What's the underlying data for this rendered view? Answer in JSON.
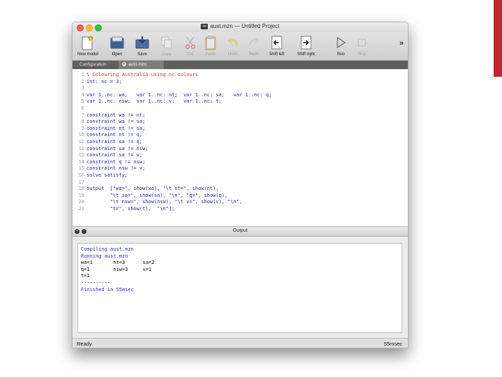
{
  "window": {
    "title": "aust.mzn — Untitled Project",
    "doc_icon": "txt"
  },
  "toolbar": {
    "buttons": [
      {
        "label": "New model",
        "icon": "new-model-icon",
        "enabled": true
      },
      {
        "label": "Open",
        "icon": "open-icon",
        "enabled": true
      },
      {
        "label": "Save",
        "icon": "save-icon",
        "enabled": true
      },
      {
        "label": "Copy",
        "icon": "copy-icon",
        "enabled": false
      },
      {
        "label": "Cut",
        "icon": "scissors-icon",
        "enabled": false
      },
      {
        "label": "Paste",
        "icon": "paste-icon",
        "enabled": false
      },
      {
        "label": "Undo",
        "icon": "undo-icon",
        "enabled": false
      },
      {
        "label": "Redo",
        "icon": "redo-icon",
        "enabled": false
      },
      {
        "label": "Shift left",
        "icon": "shift-left-icon",
        "enabled": true
      },
      {
        "label": "Shift right",
        "icon": "shift-right-icon",
        "enabled": true
      },
      {
        "label": "Run",
        "icon": "run-icon",
        "enabled": true
      },
      {
        "label": "Stop",
        "icon": "stop-icon",
        "enabled": false
      }
    ],
    "overflow": "»"
  },
  "tabs": [
    {
      "label": "Configuration",
      "active": false
    },
    {
      "label": "aust.mzn",
      "active": true,
      "close": "×"
    }
  ],
  "editor": {
    "lines": [
      {
        "num": "1",
        "text": "% Colouring Australia using nc colours"
      },
      {
        "num": "2",
        "text": "int: nc = 3;"
      },
      {
        "num": "3",
        "text": ""
      },
      {
        "num": "4",
        "text": "var 1..nc: wa;   var 1..nc: nt;  var 1..nc: sa;   var 1..nc: q;"
      },
      {
        "num": "5",
        "text": "var 1..nc: nsw;  var 1..nc: v;   var 1..nc: t;"
      },
      {
        "num": "6",
        "text": ""
      },
      {
        "num": "7",
        "text": "constraint wa != nt;"
      },
      {
        "num": "8",
        "text": "constraint wa != sa;"
      },
      {
        "num": "9",
        "text": "constraint nt != sa;"
      },
      {
        "num": "10",
        "text": "constraint nt != q;"
      },
      {
        "num": "11",
        "text": "constraint sa != q;"
      },
      {
        "num": "12",
        "text": "constraint sa != nsw;"
      },
      {
        "num": "13",
        "text": "constraint sa != v;"
      },
      {
        "num": "14",
        "text": "constraint q != nsw;"
      },
      {
        "num": "15",
        "text": "constraint nsw != v;"
      },
      {
        "num": "16",
        "text": "solve satisfy;"
      },
      {
        "num": "17",
        "text": ""
      },
      {
        "num": "18",
        "text": "output  [\"wa=\", show(wa), \"\\t nt=\", show(nt),"
      },
      {
        "num": "19",
        "text": "        \"\\t sa=\", show(sa), \"\\n\", \"q=\", show(q),"
      },
      {
        "num": "20",
        "text": "        \"\\t nsw=\", show(nsw), \"\\t v=\", show(v), \"\\n\","
      },
      {
        "num": "21",
        "text": "        \"t=\", show(t),  \"\\n\"];"
      }
    ]
  },
  "output": {
    "title": "Output",
    "lines": [
      {
        "text": "Compiling aust.mzn",
        "blue": true
      },
      {
        "text": "Running aust.mzn",
        "blue": true
      },
      {
        "text": "wa=1       nt=3      sa=2",
        "blue": false
      },
      {
        "text": "q=1        nsw=3     v=1",
        "blue": false
      },
      {
        "text": "t=1",
        "blue": false
      },
      {
        "text": "----------",
        "blue": false
      },
      {
        "text": "Finished in 55msec",
        "blue": true
      }
    ]
  },
  "status": {
    "left": "Ready.",
    "right": "55msec"
  },
  "colors": {
    "accent_bar": "#c0262d",
    "code_text": "#1a1aa8",
    "comment_text": "#d93838",
    "output_blue": "#2a2ad0"
  }
}
